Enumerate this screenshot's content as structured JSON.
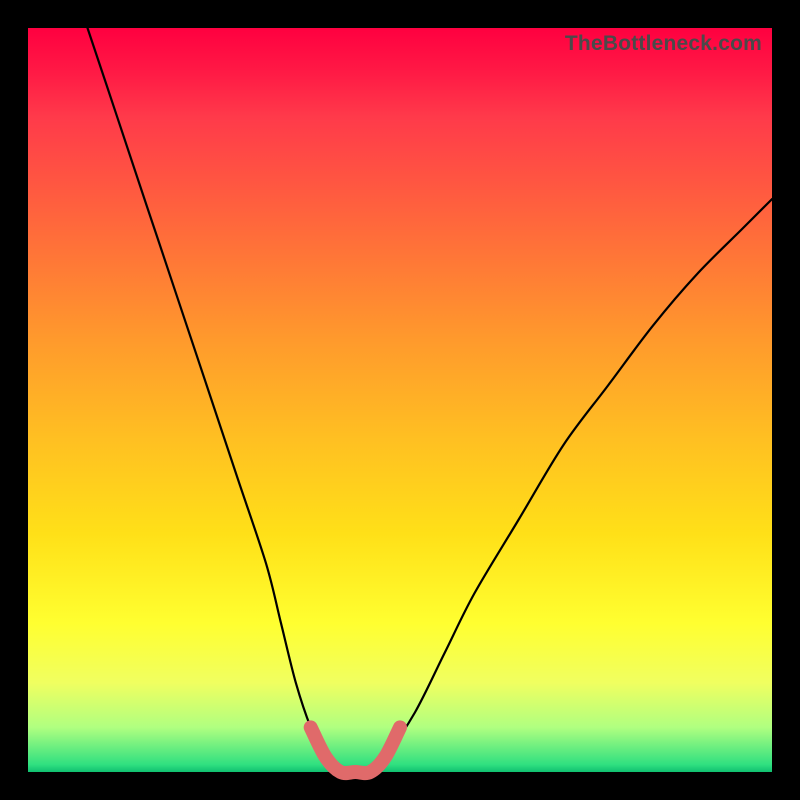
{
  "watermark": "TheBottleneck.com",
  "chart_data": {
    "type": "line",
    "title": "",
    "xlabel": "",
    "ylabel": "",
    "xlim": [
      0,
      100
    ],
    "ylim": [
      0,
      100
    ],
    "series": [
      {
        "name": "bottleneck-curve",
        "x": [
          8,
          12,
          16,
          20,
          24,
          28,
          32,
          34,
          36,
          38,
          40,
          42,
          44,
          46,
          48,
          52,
          56,
          60,
          66,
          72,
          78,
          84,
          90,
          96,
          100
        ],
        "y": [
          100,
          88,
          76,
          64,
          52,
          40,
          28,
          20,
          12,
          6,
          2,
          0,
          0,
          0,
          2,
          8,
          16,
          24,
          34,
          44,
          52,
          60,
          67,
          73,
          77
        ]
      },
      {
        "name": "minimum-highlight",
        "x": [
          38,
          40,
          42,
          44,
          46,
          48,
          50
        ],
        "y": [
          6,
          2,
          0,
          0,
          0,
          2,
          6
        ]
      }
    ],
    "gradient_stops": [
      {
        "pos": 0,
        "color": "#ff0040"
      },
      {
        "pos": 50,
        "color": "#fff030"
      },
      {
        "pos": 95,
        "color": "#c0ff60"
      },
      {
        "pos": 100,
        "color": "#10c070"
      }
    ]
  }
}
